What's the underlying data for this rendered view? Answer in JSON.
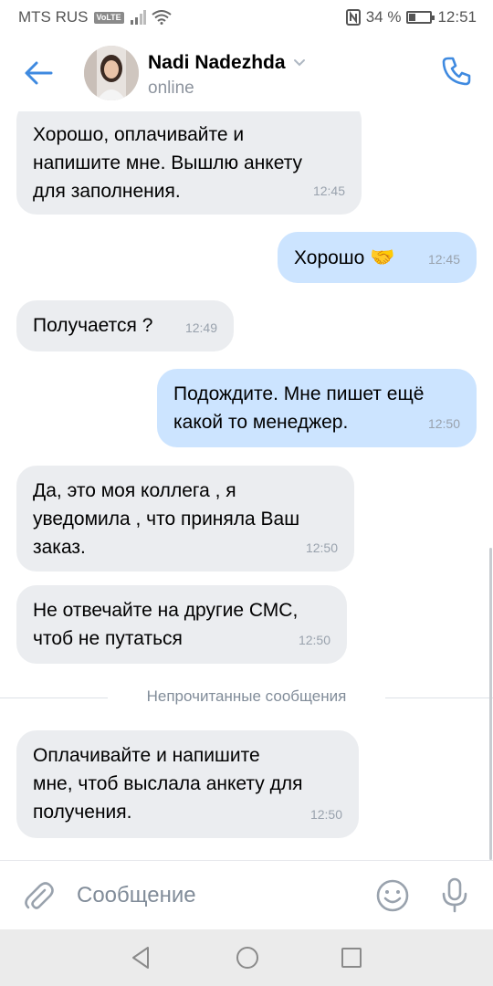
{
  "status_bar": {
    "carrier": "MTS RUS",
    "volte": "VoLTE",
    "battery_text": "34 %",
    "battery_level": 0.34,
    "time": "12:51"
  },
  "header": {
    "name": "Nadi Nadezhda",
    "status": "online",
    "accent_color": "#3f8ae0"
  },
  "messages": [
    {
      "direction": "in",
      "text": "Хорошо, оплачивайте и\nнапишите мне. Вышлю анкету\nдля заполнения.",
      "time": "12:45"
    },
    {
      "direction": "out",
      "text": "Хорошо",
      "emoji": "🤝",
      "time": "12:45"
    },
    {
      "direction": "in",
      "text": "Получается ?",
      "time": "12:49"
    },
    {
      "direction": "out",
      "text": "Подождите. Мне пишет ещё\nкакой то менеджер.",
      "time": "12:50"
    },
    {
      "direction": "in",
      "text": "Да, это моя коллега , я\nуведомила , что приняла Ваш\nзаказ.",
      "time": "12:50"
    },
    {
      "direction": "in",
      "text": "Не отвечайте на другие СМС,\nчтоб не путаться",
      "time": "12:50"
    },
    {
      "direction": "in",
      "text": "Оплачивайте и напишите\nмне, чтоб выслала анкету для\nполучения.",
      "time": "12:50"
    }
  ],
  "unread_separator": "Непрочитанные сообщения",
  "composer": {
    "placeholder": "Сообщение"
  },
  "icons": {
    "back": "arrow-left-icon",
    "call": "phone-icon",
    "attach": "paperclip-icon",
    "emoji": "smile-icon",
    "mic": "microphone-icon"
  }
}
